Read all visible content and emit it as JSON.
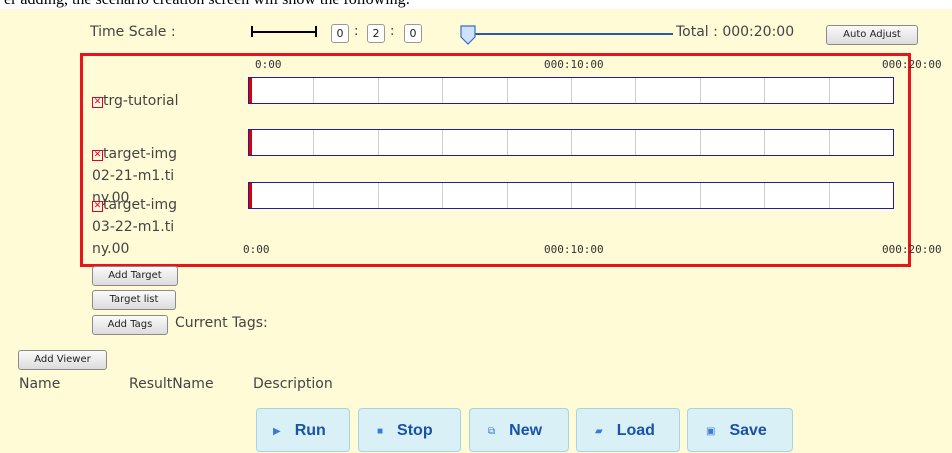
{
  "caption": "er adding, the scenario creation screen will show the following:",
  "time_scale": {
    "label": "Time Scale :",
    "hours": "0",
    "minutes": "2",
    "seconds": "0",
    "sep": ":",
    "total_label": "Total : 000:20:00",
    "auto_adjust": "Auto Adjust",
    "slider_position": 0.0
  },
  "timeline": {
    "ticks_top": [
      "0:00",
      "000:10:00",
      "000:20:00"
    ],
    "ticks_bottom": [
      "0:00",
      "000:10:00",
      "000:20:00"
    ],
    "targets": [
      {
        "label": "trg-tutorial",
        "icon": "remove-x-icon"
      },
      {
        "label": "target-img02-21-m1.tiny.00",
        "icon": "remove-x-icon"
      },
      {
        "label": "target-img03-22-m1.tiny.00",
        "icon": "remove-x-icon"
      }
    ]
  },
  "actions": {
    "add_target": "Add Target",
    "target_list": "Target list",
    "add_tags": "Add Tags",
    "current_tags": "Current Tags:",
    "add_viewer": "Add Viewer"
  },
  "columns": [
    "Name",
    "ResultName",
    "Description"
  ],
  "toolbar": {
    "run": "Run",
    "stop": "Stop",
    "new": "New",
    "load": "Load",
    "save": "Save"
  },
  "colors": {
    "background": "#fffbd7",
    "highlight_box": "#e8141c",
    "track_border": "#1d1dac",
    "cursor": "#dd0000",
    "toolbar_text": "#1a52a8",
    "toolbar_bg": "#d8f0f6"
  }
}
